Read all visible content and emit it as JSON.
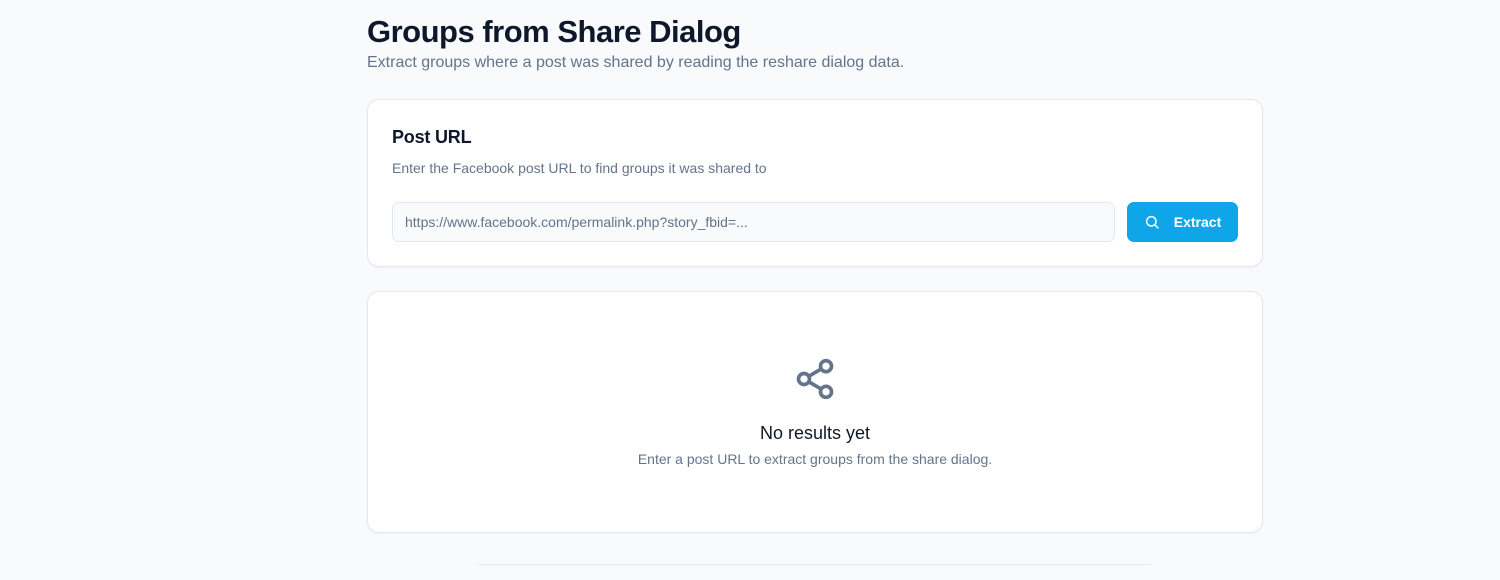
{
  "header": {
    "title": "Groups from Share Dialog",
    "subtitle": "Extract groups where a post was shared by reading the reshare dialog data."
  },
  "url_card": {
    "title": "Post URL",
    "description": "Enter the Facebook post URL to find groups it was shared to",
    "input": {
      "placeholder": "https://www.facebook.com/permalink.php?story_fbid=...",
      "value": ""
    },
    "extract_button": {
      "label": "Extract",
      "icon": "search-icon"
    }
  },
  "results_card": {
    "icon": "share-icon",
    "title": "No results yet",
    "description": "Enter a post URL to extract groups from the share dialog."
  },
  "colors": {
    "accent": "#0ea5e9",
    "background": "#f8fafc",
    "text_primary": "#0f172a",
    "text_muted": "#64748b",
    "border": "#e2e8f0"
  }
}
